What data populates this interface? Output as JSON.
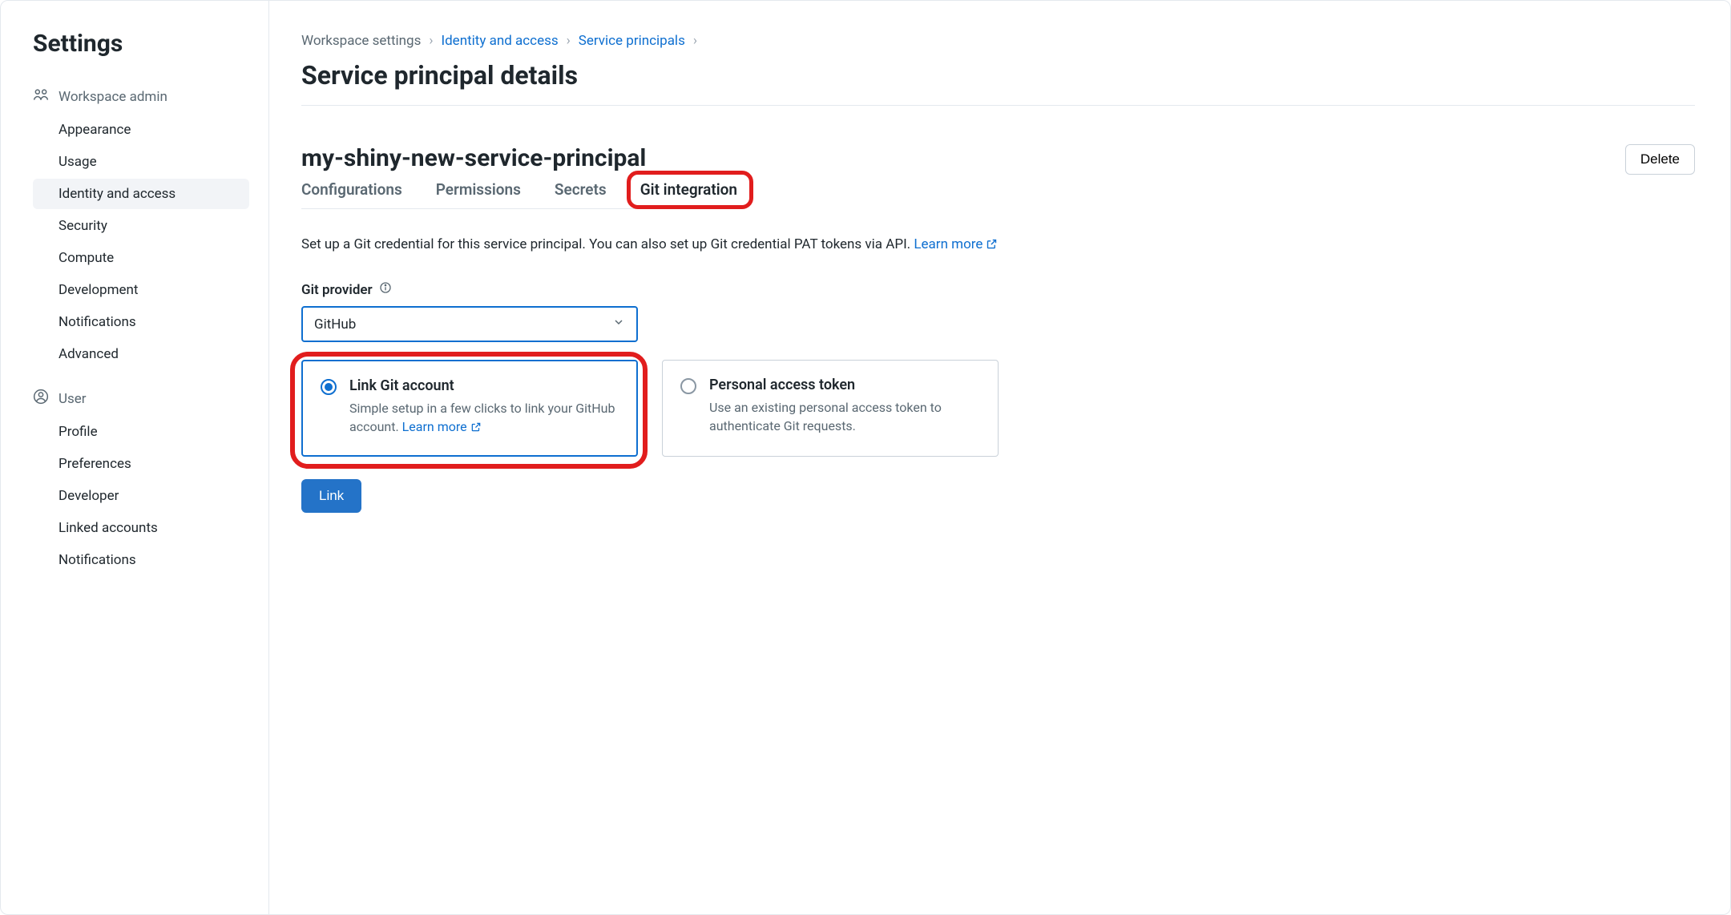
{
  "sidebar": {
    "title": "Settings",
    "groups": [
      {
        "label": "Workspace admin",
        "icon": "workspace-admin-icon",
        "items": [
          "Appearance",
          "Usage",
          "Identity and access",
          "Security",
          "Compute",
          "Development",
          "Notifications",
          "Advanced"
        ],
        "activeIndex": 2
      },
      {
        "label": "User",
        "icon": "user-icon",
        "items": [
          "Profile",
          "Preferences",
          "Developer",
          "Linked accounts",
          "Notifications"
        ],
        "activeIndex": -1
      }
    ]
  },
  "breadcrumb": {
    "items": [
      {
        "label": "Workspace settings",
        "link": false
      },
      {
        "label": "Identity and access",
        "link": true
      },
      {
        "label": "Service principals",
        "link": true
      }
    ]
  },
  "pageTitle": "Service principal details",
  "entityName": "my-shiny-new-service-principal",
  "deleteLabel": "Delete",
  "tabs": {
    "items": [
      "Configurations",
      "Permissions",
      "Secrets",
      "Git integration"
    ],
    "activeIndex": 3
  },
  "description": {
    "text": "Set up a Git credential for this service principal. You can also set up Git credential PAT tokens via API. ",
    "learnMore": "Learn more"
  },
  "provider": {
    "label": "Git provider",
    "value": "GitHub"
  },
  "options": {
    "linkAccount": {
      "title": "Link Git account",
      "desc": "Simple setup in a few clicks to link your GitHub account. ",
      "learnMore": "Learn more"
    },
    "pat": {
      "title": "Personal access token",
      "desc": "Use an existing personal access token to authenticate Git requests."
    },
    "selected": "linkAccount"
  },
  "linkButton": "Link"
}
